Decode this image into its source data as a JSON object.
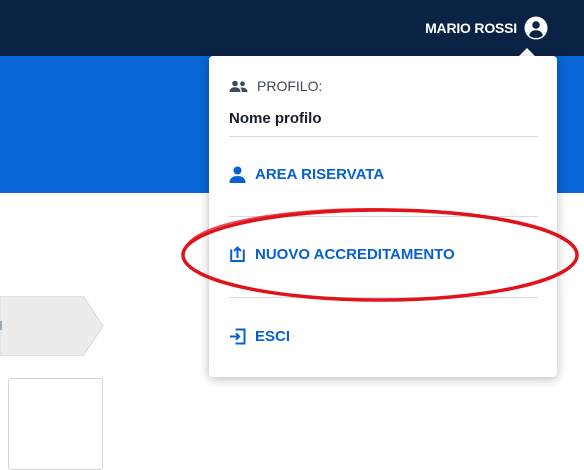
{
  "header": {
    "user_name": "MARIO ROSSI"
  },
  "dropdown": {
    "profile_label": "PROFILO:",
    "profile_name": "Nome profilo",
    "items": [
      {
        "label": "AREA RISERVATA",
        "icon": "user-icon"
      },
      {
        "label": "NUOVO ACCREDITAMENTO",
        "icon": "upload-icon"
      },
      {
        "label": "ESCI",
        "icon": "logout-icon"
      }
    ]
  },
  "colors": {
    "topbar": "#0a2345",
    "bluebar": "#0866d6",
    "link": "#0660cf",
    "annotation": "#e0131b"
  }
}
